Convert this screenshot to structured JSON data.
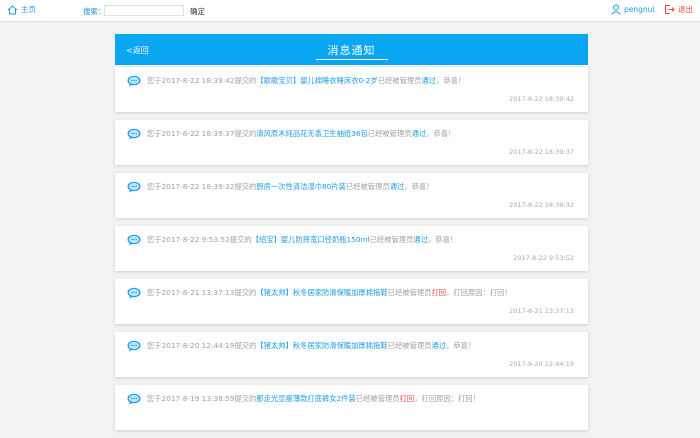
{
  "topbar": {
    "home_label": "主页",
    "search_label": "搜索：",
    "search_value": "",
    "search_button": "确定",
    "username": "pengnui",
    "logout_label": "退出"
  },
  "header": {
    "back_label": "<返回",
    "title": "消息通知"
  },
  "colors": {
    "accent": "#0ba6f1",
    "link": "#1e9be8",
    "fail": "#e8483a"
  },
  "messages": [
    {
      "pre": "您于2017-8-22 18:39:42提交的",
      "product": "【歌歌宝贝】婴儿棉睡衣睡床衣0-2岁",
      "mid": "已经被管理员",
      "status": "通过",
      "status_type": "pass",
      "post": "，恭喜！",
      "timestamp": "2017-8-22 18:39:42"
    },
    {
      "pre": "您于2017-8-22 18:39:37提交的",
      "product": "清风原木纯品花无香卫生抽纸36包",
      "mid": "已经被管理员",
      "status": "通过",
      "status_type": "pass",
      "post": "，恭喜！",
      "timestamp": "2017-8-22 18:39:37"
    },
    {
      "pre": "您于2017-8-22 18:39:32提交的",
      "product": "厨房一次性清洁湿巾80片装",
      "mid": "已经被管理员",
      "status": "通过",
      "status_type": "pass",
      "post": "，恭喜！",
      "timestamp": "2017-8-22 18:39:32"
    },
    {
      "pre": "您于2017-8-22 9:53:52提交的",
      "product": "【绍宝】婴儿防摔宽口径奶瓶150ml",
      "mid": "已经被管理员",
      "status": "通过",
      "status_type": "pass",
      "post": "，恭喜！",
      "timestamp": "2017-8-22 9:53:52"
    },
    {
      "pre": "您于2017-8-21 13:37:13提交的",
      "product": "【猪太帅】秋冬居家防滑保暖加厚棉拖鞋",
      "mid": "已经被管理员",
      "status": "打回",
      "status_type": "fail",
      "post": "，打回原因：打回！",
      "timestamp": "2017-8-21 13:37:13"
    },
    {
      "pre": "您于2017-8-20 12:44:19提交的",
      "product": "【猪太帅】秋冬居家防滑保暖加厚棉拖鞋",
      "mid": "已经被管理员",
      "status": "通过",
      "status_type": "pass",
      "post": "，恭喜！",
      "timestamp": "2017-8-20 12:44:19"
    },
    {
      "pre": "您于2017-8-19 13:38:59提交的",
      "product": "那走光显瘦薄款打底裤女2件装",
      "mid": "已经被管理员",
      "status": "打回",
      "status_type": "fail",
      "post": "，打回原因：打回！",
      "timestamp": ""
    }
  ]
}
